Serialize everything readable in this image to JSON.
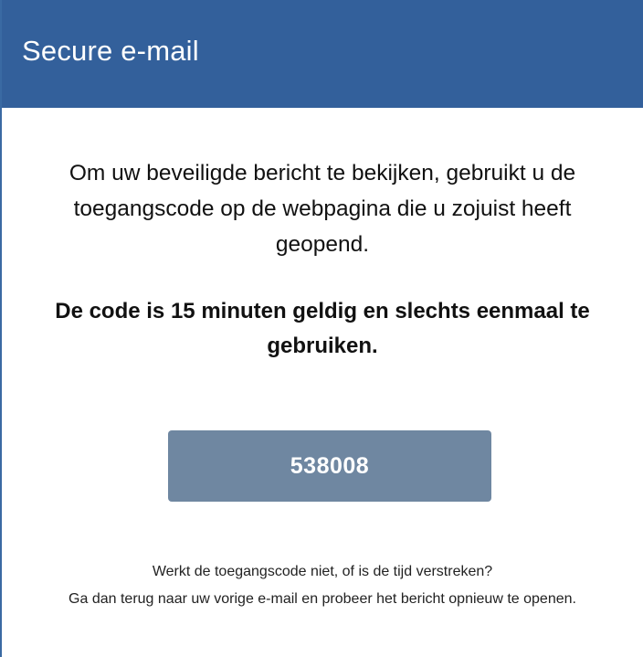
{
  "header": {
    "title": "Secure e-mail"
  },
  "message": {
    "instruction": "Om uw beveiligde bericht te bekijken, gebruikt u de toegangscode op de webpagina die u zojuist heeft geopend.",
    "validity": "De code is 15 minuten geldig en slechts eenmaal te gebruiken."
  },
  "access_code": {
    "value": "538008"
  },
  "help": {
    "line1": "Werkt de toegangscode niet, of is de tijd verstreken?",
    "line2": "Ga dan terug naar uw vorige e-mail en probeer het bericht opnieuw te openen."
  },
  "colors": {
    "header_bg": "#33609b",
    "code_box_bg": "#6f87a1"
  }
}
